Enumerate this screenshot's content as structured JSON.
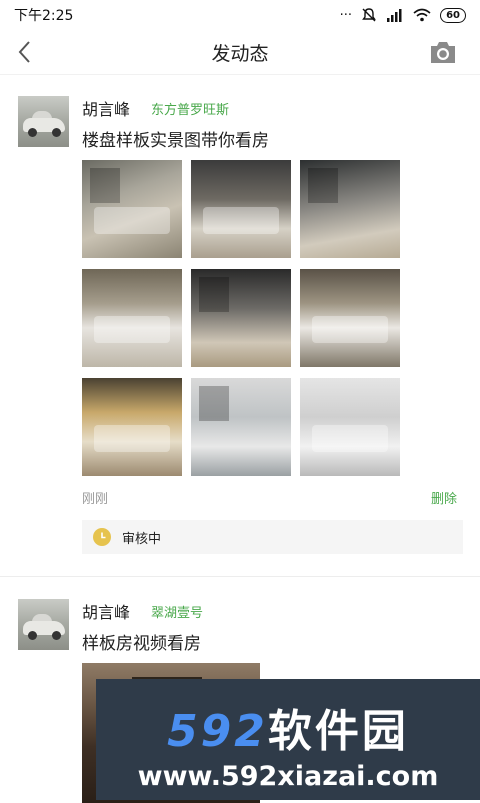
{
  "status_bar": {
    "time": "下午2:25",
    "battery": "60",
    "icons": [
      "dots-icon",
      "mute-icon",
      "signal-icon",
      "wifi-icon",
      "battery-icon"
    ]
  },
  "nav": {
    "title": "发动态",
    "back_icon": "back-chevron-icon",
    "camera_icon": "camera-icon"
  },
  "posts": [
    {
      "username": "胡言峰",
      "community": "东方普罗旺斯",
      "text": "楼盘样板实景图带你看房",
      "photos": [
        "living-room",
        "kitchen",
        "study",
        "bedroom",
        "walk-in-closet",
        "bedroom",
        "kids-bedroom",
        "shower",
        "bathroom"
      ],
      "time": "刚刚",
      "delete_label": "删除",
      "review_status": "审核中"
    },
    {
      "username": "胡言峰",
      "community": "翠湖壹号",
      "text": "样板房视频看房"
    }
  ],
  "watermark": {
    "number": "592",
    "name": "软件园",
    "url": "www.592xiazai.com"
  },
  "colors": {
    "accent_green": "#49a84b",
    "review_box": "#f5f5f5",
    "clock_yellow": "#e6c34e",
    "watermark_bg": "#2f3b49",
    "watermark_blue": "#4a8ef0"
  }
}
